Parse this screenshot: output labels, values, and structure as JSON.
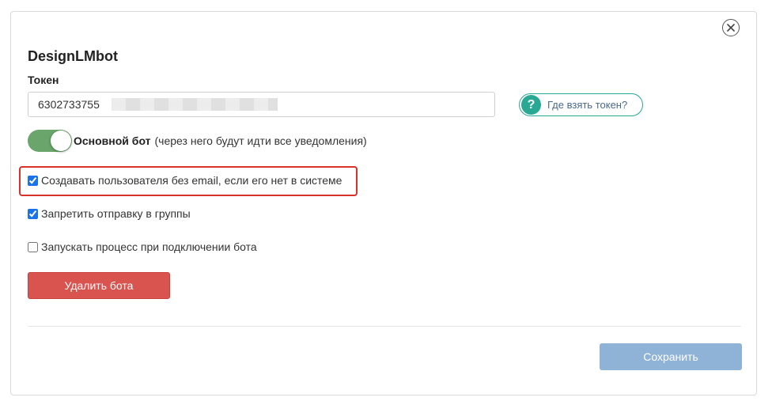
{
  "dialog": {
    "title": "DesignLMbot",
    "close_icon": "close-icon",
    "token": {
      "label": "Токен",
      "value": "6302733755                                        SYVr1zJc"
    },
    "help": {
      "icon": "question-icon",
      "icon_glyph": "?",
      "label": "Где взять токен?"
    },
    "main_bot": {
      "enabled": true,
      "title": "Основной бот",
      "description": "(через него будут идти все уведомления)"
    },
    "options": [
      {
        "label": "Создавать пользователя без email, если его нет в системе",
        "checked": true,
        "highlighted": true
      },
      {
        "label": "Запретить отправку в группы",
        "checked": true
      },
      {
        "label": "Запускать процесс при подключении бота",
        "checked": false
      }
    ],
    "delete_label": "Удалить бота",
    "save_label": "Сохранить"
  },
  "colors": {
    "accent_teal": "#29a894",
    "toggle_green": "#6aa56b",
    "delete_red": "#d9534f",
    "save_blue": "#8fb3d6",
    "highlight_red": "#d9322b"
  }
}
